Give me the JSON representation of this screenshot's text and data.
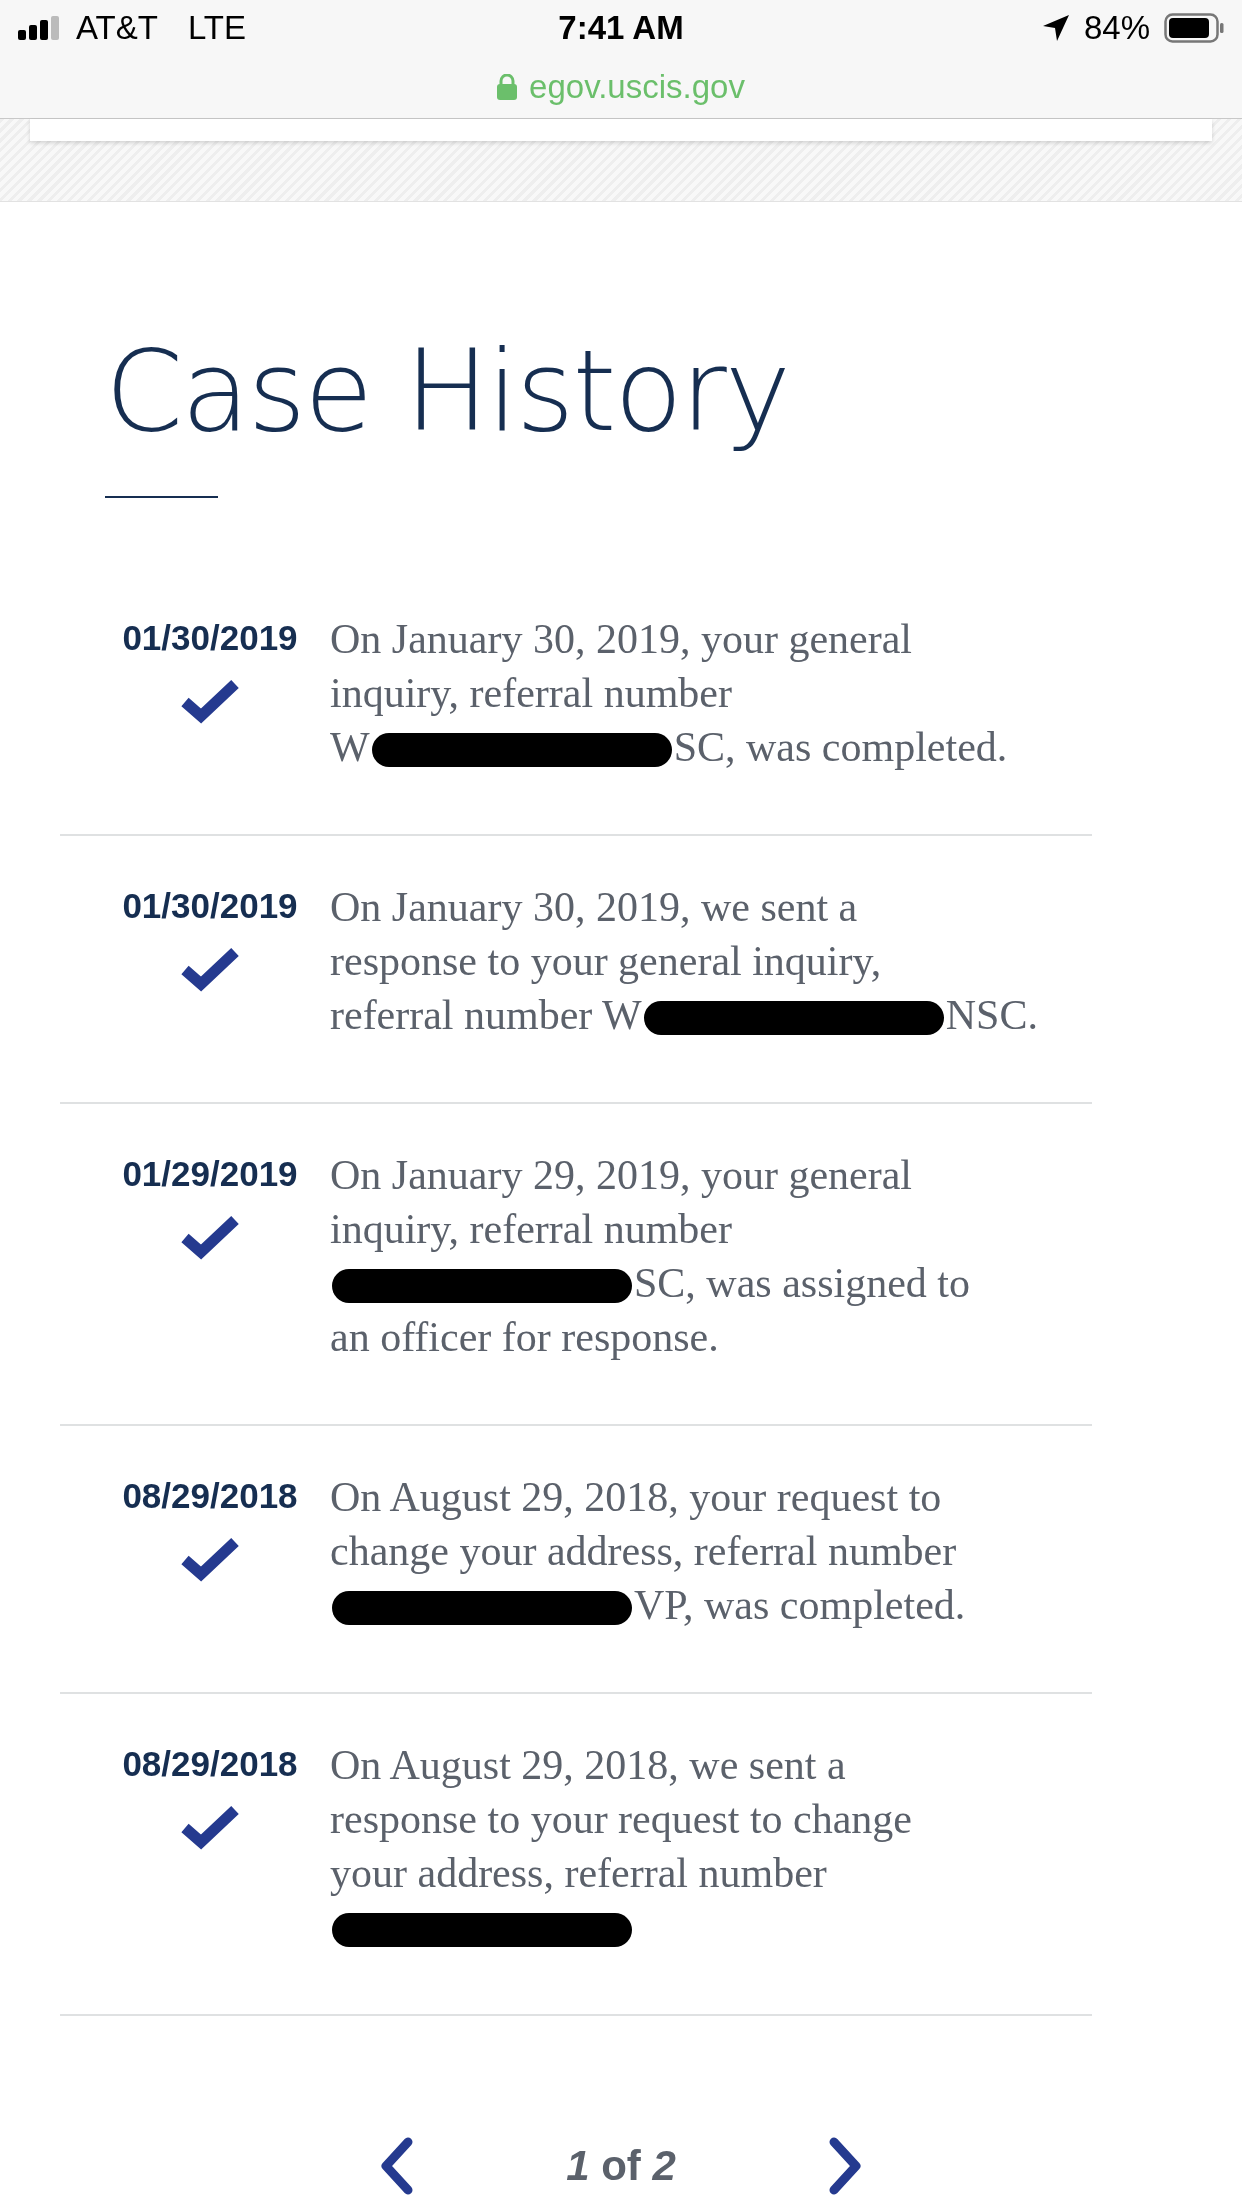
{
  "status_bar": {
    "carrier": "AT&T",
    "network": "LTE",
    "time": "7:41 AM",
    "battery": "84%"
  },
  "address_bar": {
    "url": "egov.uscis.gov"
  },
  "title": "Case History",
  "entries": [
    {
      "date": "01/30/2019",
      "completed": true,
      "lines": [
        {
          "before": "On January 30, 2019, your general",
          "redacted": false
        },
        {
          "before": "inquiry, referral number",
          "redacted": false
        },
        {
          "before": "W",
          "redacted": true,
          "after": "SC, was completed."
        }
      ]
    },
    {
      "date": "01/30/2019",
      "completed": true,
      "lines": [
        {
          "before": "On January 30, 2019, we sent a",
          "redacted": false
        },
        {
          "before": "response to your general inquiry,",
          "redacted": false
        },
        {
          "before": "referral number W",
          "redacted": true,
          "after": "NSC."
        }
      ]
    },
    {
      "date": "01/29/2019",
      "completed": true,
      "lines": [
        {
          "before": "On January 29, 2019, your general",
          "redacted": false
        },
        {
          "before": "inquiry, referral number",
          "redacted": false
        },
        {
          "redacted": true,
          "after": "SC, was assigned to"
        },
        {
          "before": "an officer for response.",
          "redacted": false
        }
      ]
    },
    {
      "date": "08/29/2018",
      "completed": true,
      "lines": [
        {
          "before": "On August 29, 2018, your request to",
          "redacted": false
        },
        {
          "before": "change your address, referral number",
          "redacted": false
        },
        {
          "redacted": true,
          "after": "VP, was completed."
        }
      ]
    },
    {
      "date": "08/29/2018",
      "completed": true,
      "lines": [
        {
          "before": "On August 29, 2018, we sent a",
          "redacted": false
        },
        {
          "before": "response to your request to change",
          "redacted": false
        },
        {
          "before": "your address, referral number",
          "redacted": false
        },
        {
          "redacted": true
        }
      ]
    }
  ],
  "pagination": {
    "label": "*1* of *2*"
  }
}
